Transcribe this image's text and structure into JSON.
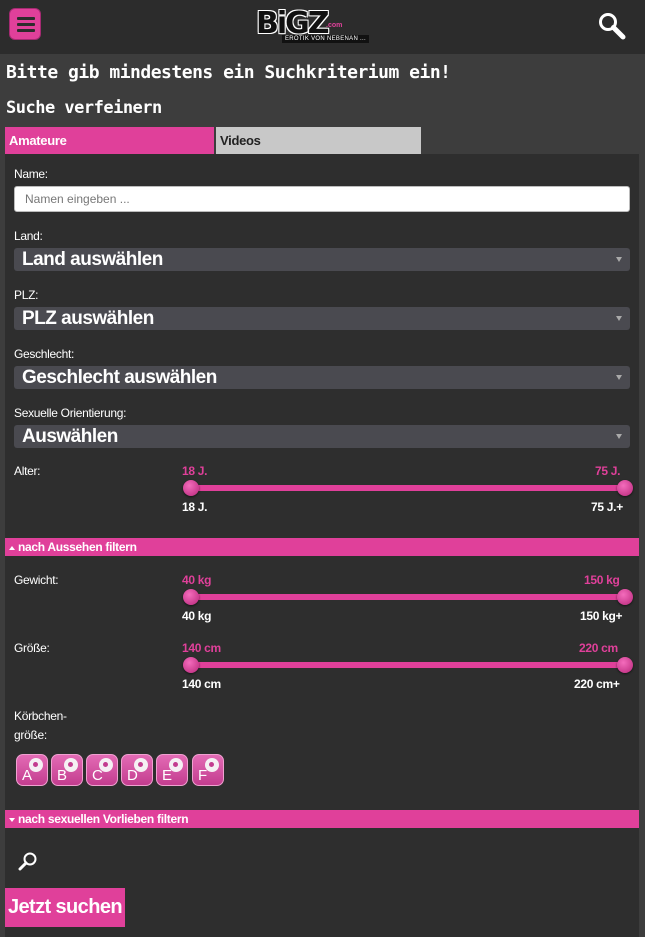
{
  "header": {
    "logo_text": "BiGZ",
    "logo_suffix": ".com",
    "logo_tagline": "EROTIK VON NEBENAN ..."
  },
  "notice": "Bitte gib mindestens ein Suchkriterium ein!",
  "refine_title": "Suche verfeinern",
  "tabs": [
    {
      "label": "Amateure",
      "active": true
    },
    {
      "label": "Videos",
      "active": false
    }
  ],
  "form": {
    "name_label": "Name:",
    "name_placeholder": "Namen eingeben ...",
    "country_label": "Land:",
    "country_value": "Land auswählen",
    "zip_label": "PLZ:",
    "zip_value": "PLZ auswählen",
    "gender_label": "Geschlecht:",
    "gender_value": "Geschlecht auswählen",
    "orientation_label": "Sexuelle Orientierung:",
    "orientation_value": "Auswählen",
    "age": {
      "label": "Alter:",
      "min": "18 J.",
      "max": "75 J.",
      "min_below": "18 J.",
      "max_below": "75 J.+"
    },
    "appearance_section": "nach Aussehen filtern",
    "weight": {
      "label": "Gewicht:",
      "min": "40 kg",
      "max": "150 kg",
      "min_below": "40 kg",
      "max_below": "150 kg+"
    },
    "height": {
      "label": "Größe:",
      "min": "140 cm",
      "max": "220 cm",
      "min_below": "140 cm",
      "max_below": "220 cm+"
    },
    "cup_label_line1": "Körbchen-",
    "cup_label_line2": "größe:",
    "cup_sizes": [
      "A",
      "B",
      "C",
      "D",
      "E",
      "F"
    ],
    "preferences_section": "nach sexuellen Vorlieben filtern",
    "submit_label": "Jetzt suchen"
  },
  "colors": {
    "accent": "#e0409a",
    "background": "#3d3d3d",
    "panel": "#2e2e2e",
    "tab_inactive": "#c8c8c8"
  }
}
